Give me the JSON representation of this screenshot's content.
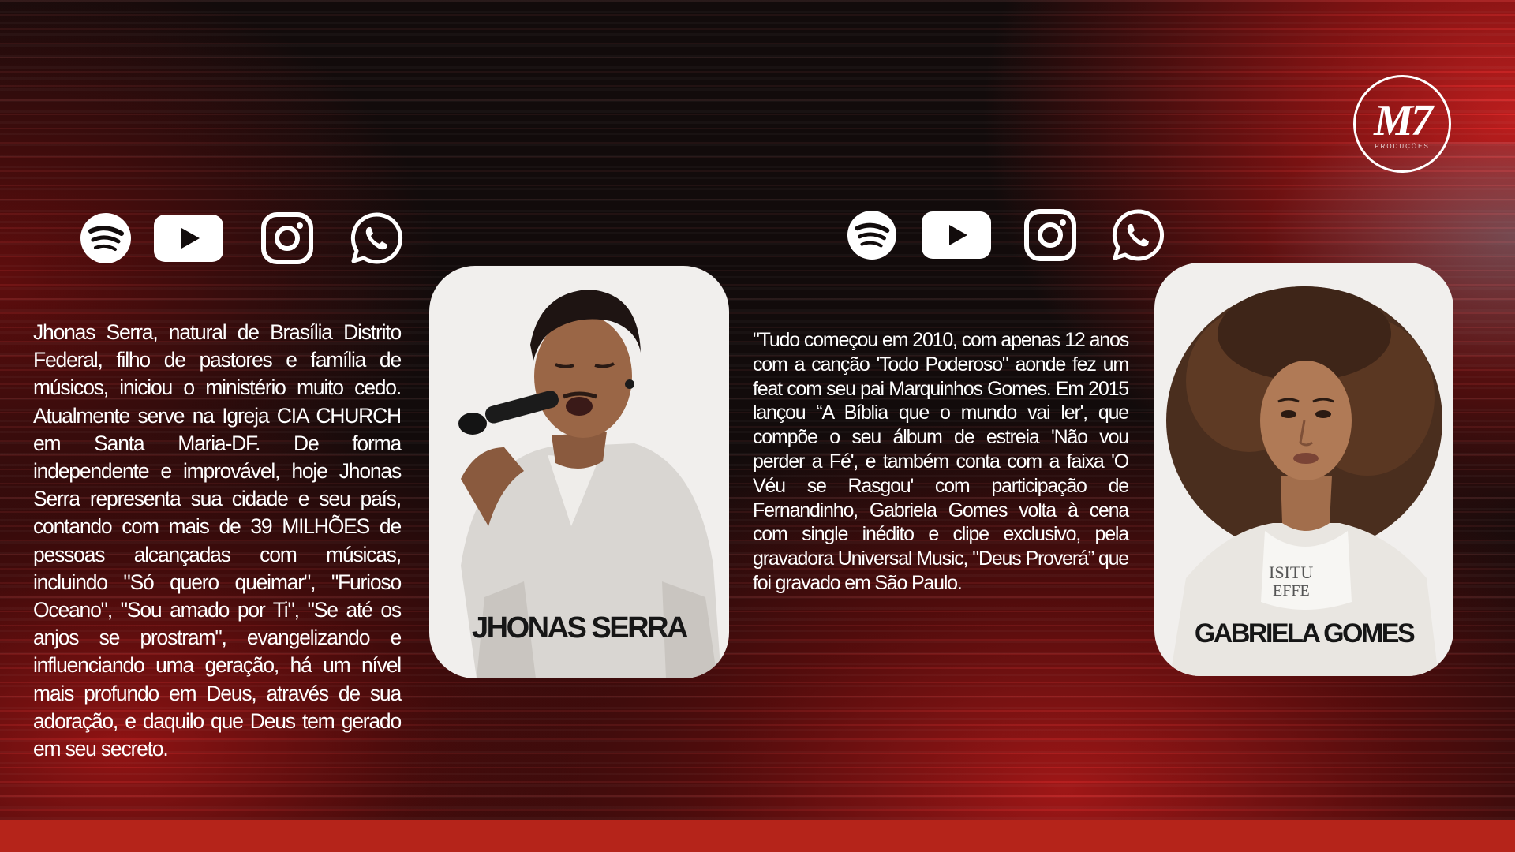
{
  "brand": {
    "logo_text": "M7",
    "logo_subtitle": "PRODUÇÕES"
  },
  "social_icons": [
    "spotify-icon",
    "youtube-icon",
    "instagram-icon",
    "whatsapp-icon"
  ],
  "colors": {
    "accent_red": "#b5241a",
    "background_dark": "#140c0c",
    "card_background": "#f1efed",
    "text_light": "#ffffff",
    "text_dark": "#161616"
  },
  "artists": [
    {
      "name": "JHONAS SERRA",
      "bio": "Jhonas Serra, natural de Brasília Distrito Federal, filho de pastores e família de músicos, iniciou o ministério muito cedo. Atualmente serve na Igreja CIA CHURCH em Santa Maria-DF. De forma independente e improvável, hoje Jhonas Serra representa sua cidade e seu país, contando com mais de 39 MILHÕES de pessoas alcançadas com músicas, incluindo \"Só quero queimar\", \"Furioso Oceano\", \"Sou amado por Ti\", \"Se até os anjos se prostram\", evangelizando e influenciando uma geração, há um nível mais profundo em Deus, através de sua adoração, e daquilo que Deus tem gerado em seu secreto."
    },
    {
      "name": "GABRIELA GOMES",
      "bio": "\"Tudo começou em 2010, com apenas 12 anos com a canção 'Todo Poderoso\" aonde fez um feat com seu pai Marquinhos Gomes. Em 2015 lançou “A Bíblia que o mundo vai ler', que compõe o seu álbum de estreia 'Não vou perder a Fé', e também conta com a faixa 'O Véu se Rasgou' com participação de Fernandinho, Gabriela Gomes volta à cena com single inédito e clipe exclusivo, pela gravadora Universal Music, \"Deus Proverá” que foi gravado em São Paulo."
    }
  ]
}
